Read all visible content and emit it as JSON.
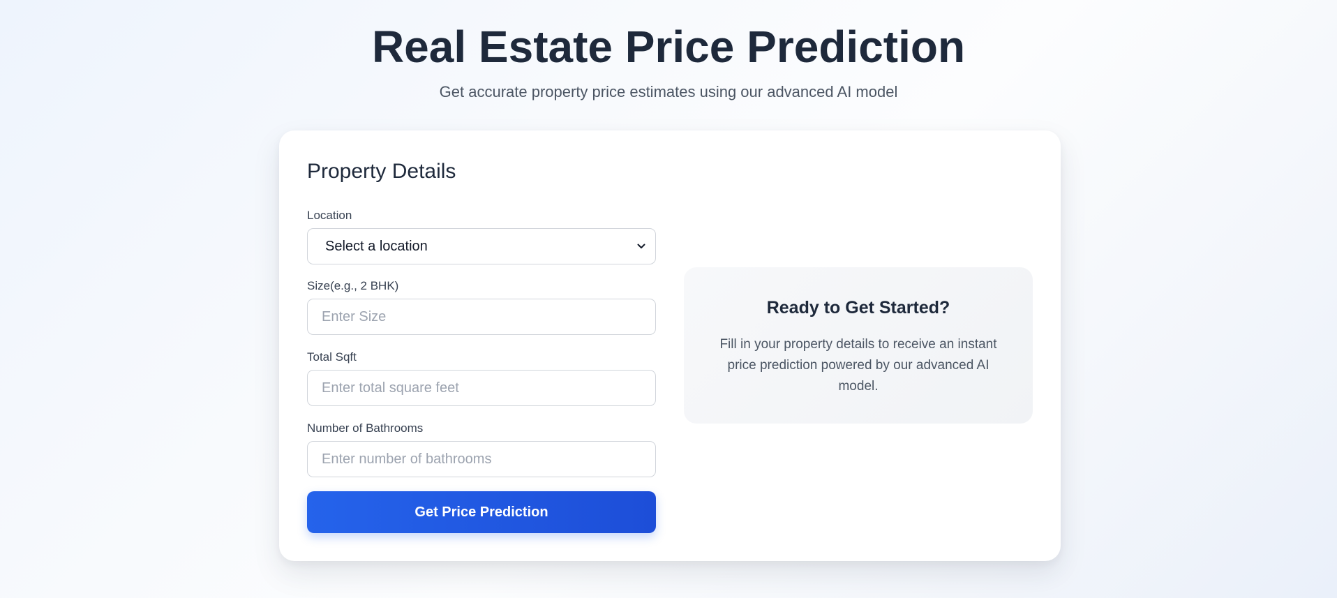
{
  "header": {
    "title": "Real Estate Price Prediction",
    "subtitle": "Get accurate property price estimates using our advanced AI model"
  },
  "form": {
    "title": "Property Details",
    "location": {
      "label": "Location",
      "selected": "Select a location"
    },
    "size": {
      "label": "Size(e.g., 2 BHK)",
      "placeholder": "Enter Size",
      "value": ""
    },
    "sqft": {
      "label": "Total Sqft",
      "placeholder": "Enter total square feet",
      "value": ""
    },
    "bathrooms": {
      "label": "Number of Bathrooms",
      "placeholder": "Enter number of bathrooms",
      "value": ""
    },
    "submit_label": "Get Price Prediction"
  },
  "info_panel": {
    "title": "Ready to Get Started?",
    "text": "Fill in your property details to receive an instant price prediction powered by our advanced AI model."
  },
  "icons": {
    "select_chevron": "chevron-down-icon"
  },
  "colors": {
    "accent": "#2563eb",
    "accent_dark": "#1d4ed8",
    "heading": "#1e293b",
    "muted": "#4b5563"
  }
}
